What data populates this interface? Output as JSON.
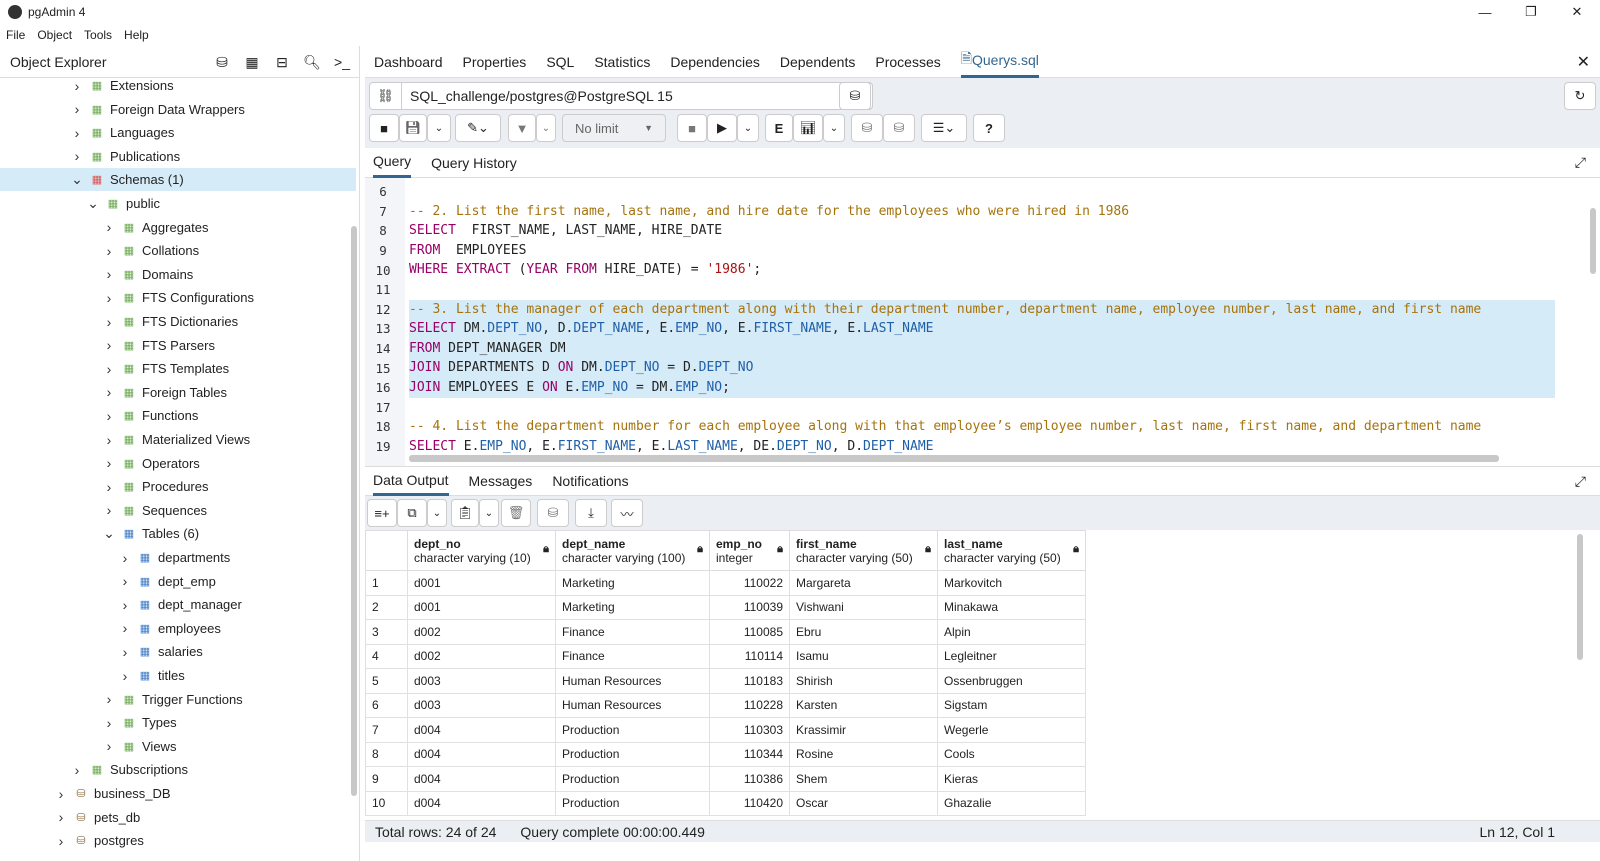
{
  "app": {
    "title": "pgAdmin 4"
  },
  "menu": [
    "File",
    "Object",
    "Tools",
    "Help"
  ],
  "explorer": {
    "title": "Object Explorer",
    "nodes": [
      {
        "label": "Extensions",
        "level": 3,
        "icon": "extension-icon"
      },
      {
        "label": "Foreign Data Wrappers",
        "level": 3,
        "icon": "fdw-icon"
      },
      {
        "label": "Languages",
        "level": 3,
        "icon": "language-icon"
      },
      {
        "label": "Publications",
        "level": 3,
        "icon": "publication-icon"
      },
      {
        "label": "Schemas (1)",
        "level": 3,
        "icon": "schema-icon",
        "expanded": true,
        "selected": true
      },
      {
        "label": "public",
        "level": 4,
        "icon": "schema-public-icon",
        "expanded": true
      },
      {
        "label": "Aggregates",
        "level": 5,
        "icon": "aggregate-icon"
      },
      {
        "label": "Collations",
        "level": 5,
        "icon": "collation-icon"
      },
      {
        "label": "Domains",
        "level": 5,
        "icon": "domain-icon"
      },
      {
        "label": "FTS Configurations",
        "level": 5,
        "icon": "fts-config-icon"
      },
      {
        "label": "FTS Dictionaries",
        "level": 5,
        "icon": "fts-dictionary-icon"
      },
      {
        "label": "FTS Parsers",
        "level": 5,
        "icon": "fts-parser-icon"
      },
      {
        "label": "FTS Templates",
        "level": 5,
        "icon": "fts-template-icon"
      },
      {
        "label": "Foreign Tables",
        "level": 5,
        "icon": "foreign-table-icon"
      },
      {
        "label": "Functions",
        "level": 5,
        "icon": "function-icon"
      },
      {
        "label": "Materialized Views",
        "level": 5,
        "icon": "mview-icon"
      },
      {
        "label": "Operators",
        "level": 5,
        "icon": "operator-icon"
      },
      {
        "label": "Procedures",
        "level": 5,
        "icon": "procedure-icon"
      },
      {
        "label": "Sequences",
        "level": 5,
        "icon": "sequence-icon"
      },
      {
        "label": "Tables (6)",
        "level": 5,
        "icon": "tables-icon",
        "expanded": true
      },
      {
        "label": "departments",
        "level": 6,
        "icon": "table-icon"
      },
      {
        "label": "dept_emp",
        "level": 6,
        "icon": "table-icon"
      },
      {
        "label": "dept_manager",
        "level": 6,
        "icon": "table-icon"
      },
      {
        "label": "employees",
        "level": 6,
        "icon": "table-icon"
      },
      {
        "label": "salaries",
        "level": 6,
        "icon": "table-icon"
      },
      {
        "label": "titles",
        "level": 6,
        "icon": "table-icon"
      },
      {
        "label": "Trigger Functions",
        "level": 5,
        "icon": "trigger-function-icon"
      },
      {
        "label": "Types",
        "level": 5,
        "icon": "type-icon"
      },
      {
        "label": "Views",
        "level": 5,
        "icon": "view-icon"
      },
      {
        "label": "Subscriptions",
        "level": 3,
        "icon": "subscription-icon"
      },
      {
        "label": "business_DB",
        "level": 2,
        "icon": "database-icon"
      },
      {
        "label": "pets_db",
        "level": 2,
        "icon": "database-icon"
      },
      {
        "label": "postgres",
        "level": 2,
        "icon": "database-icon"
      }
    ]
  },
  "tabs": [
    "Dashboard",
    "Properties",
    "SQL",
    "Statistics",
    "Dependencies",
    "Dependents",
    "Processes",
    "Querys.sql"
  ],
  "connection": "SQL_challenge/postgres@PostgreSQL 15",
  "limit": "No limit",
  "query_tabs": [
    "Query",
    "Query History"
  ],
  "editor_lines": [
    {
      "n": "6",
      "t": []
    },
    {
      "n": "7",
      "t": [
        [
          "cm",
          "-- 2. List the first name, last name, and hire date for the employees who were hired in 1986"
        ]
      ]
    },
    {
      "n": "8",
      "t": [
        [
          "kw",
          "SELECT"
        ],
        [
          "",
          "  FIRST_NAME, LAST_NAME, HIRE_DATE"
        ]
      ]
    },
    {
      "n": "9",
      "t": [
        [
          "kw",
          "FROM"
        ],
        [
          "",
          "  EMPLOYEES"
        ]
      ]
    },
    {
      "n": "10",
      "t": [
        [
          "kw",
          "WHERE EXTRACT"
        ],
        [
          "",
          " ("
        ],
        [
          "kw",
          "YEAR FROM"
        ],
        [
          "",
          " HIRE_DATE) = "
        ],
        [
          "st",
          "'1986'"
        ],
        [
          "",
          ";"
        ]
      ]
    },
    {
      "n": "11",
      "t": []
    },
    {
      "n": "12",
      "hl": true,
      "t": [
        [
          "cm",
          "-- 3. List the manager of each department along with their department number, department name, employee number, last name, and first name"
        ]
      ]
    },
    {
      "n": "13",
      "hl": true,
      "t": [
        [
          "kw",
          "SELECT"
        ],
        [
          "",
          " DM."
        ],
        [
          "pr",
          "DEPT_NO"
        ],
        [
          "",
          ", D."
        ],
        [
          "pr",
          "DEPT_NAME"
        ],
        [
          "",
          ", E."
        ],
        [
          "pr",
          "EMP_NO"
        ],
        [
          "",
          ", E."
        ],
        [
          "pr",
          "FIRST_NAME"
        ],
        [
          "",
          ", E."
        ],
        [
          "pr",
          "LAST_NAME"
        ]
      ]
    },
    {
      "n": "14",
      "hl": true,
      "t": [
        [
          "kw",
          "FROM"
        ],
        [
          "",
          " DEPT_MANAGER DM"
        ]
      ]
    },
    {
      "n": "15",
      "hl": true,
      "t": [
        [
          "kw",
          "JOIN"
        ],
        [
          "",
          " DEPARTMENTS D "
        ],
        [
          "kw",
          "ON"
        ],
        [
          "",
          " DM."
        ],
        [
          "pr",
          "DEPT_NO"
        ],
        [
          "",
          " = D."
        ],
        [
          "pr",
          "DEPT_NO"
        ]
      ]
    },
    {
      "n": "16",
      "hl": true,
      "t": [
        [
          "kw",
          "JOIN"
        ],
        [
          "",
          " EMPLOYEES E "
        ],
        [
          "kw",
          "ON"
        ],
        [
          "",
          " E."
        ],
        [
          "pr",
          "EMP_NO"
        ],
        [
          "",
          " = DM."
        ],
        [
          "pr",
          "EMP_NO"
        ],
        [
          "",
          ";"
        ]
      ]
    },
    {
      "n": "17",
      "t": []
    },
    {
      "n": "18",
      "t": [
        [
          "cm",
          "-- 4. List the department number for each employee along with that employee’s employee number, last name, first name, and department name"
        ]
      ]
    },
    {
      "n": "19",
      "t": [
        [
          "kw",
          "SELECT"
        ],
        [
          "",
          " E."
        ],
        [
          "pr",
          "EMP_NO"
        ],
        [
          "",
          ", E."
        ],
        [
          "pr",
          "FIRST_NAME"
        ],
        [
          "",
          ", E."
        ],
        [
          "pr",
          "LAST_NAME"
        ],
        [
          "",
          ", DE."
        ],
        [
          "pr",
          "DEPT_NO"
        ],
        [
          "",
          ", D."
        ],
        [
          "pr",
          "DEPT_NAME"
        ]
      ]
    }
  ],
  "output_tabs": [
    "Data Output",
    "Messages",
    "Notifications"
  ],
  "columns": [
    {
      "name": "dept_no",
      "type": "character varying (10)"
    },
    {
      "name": "dept_name",
      "type": "character varying (100)"
    },
    {
      "name": "emp_no",
      "type": "integer"
    },
    {
      "name": "first_name",
      "type": "character varying (50)"
    },
    {
      "name": "last_name",
      "type": "character varying (50)"
    }
  ],
  "rows": [
    [
      "1",
      "d001",
      "Marketing",
      "110022",
      "Margareta",
      "Markovitch"
    ],
    [
      "2",
      "d001",
      "Marketing",
      "110039",
      "Vishwani",
      "Minakawa"
    ],
    [
      "3",
      "d002",
      "Finance",
      "110085",
      "Ebru",
      "Alpin"
    ],
    [
      "4",
      "d002",
      "Finance",
      "110114",
      "Isamu",
      "Legleitner"
    ],
    [
      "5",
      "d003",
      "Human Resources",
      "110183",
      "Shirish",
      "Ossenbruggen"
    ],
    [
      "6",
      "d003",
      "Human Resources",
      "110228",
      "Karsten",
      "Sigstam"
    ],
    [
      "7",
      "d004",
      "Production",
      "110303",
      "Krassimir",
      "Wegerle"
    ],
    [
      "8",
      "d004",
      "Production",
      "110344",
      "Rosine",
      "Cools"
    ],
    [
      "9",
      "d004",
      "Production",
      "110386",
      "Shem",
      "Kieras"
    ],
    [
      "10",
      "d004",
      "Production",
      "110420",
      "Oscar",
      "Ghazalie"
    ]
  ],
  "status": {
    "total": "Total rows: 24 of 24",
    "query": "Query complete 00:00:00.449",
    "cursor": "Ln 12, Col 1"
  }
}
